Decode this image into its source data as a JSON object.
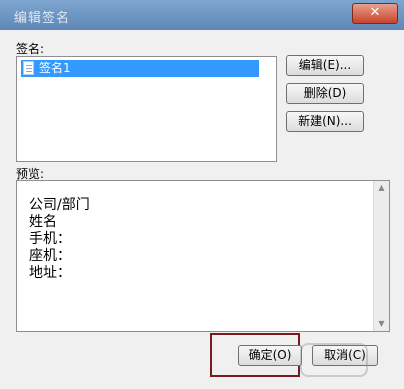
{
  "window": {
    "title": "编辑签名",
    "close_glyph": "✕"
  },
  "signatures": {
    "label": "签名:",
    "items": [
      "签名1"
    ]
  },
  "buttons": {
    "edit": "编辑(E)...",
    "delete": "删除(D)",
    "new": "新建(N)...",
    "ok": "确定(O)",
    "cancel": "取消(C)"
  },
  "preview": {
    "label": "预览:",
    "lines": [
      "公司/部门",
      "姓名",
      "手机：",
      "座机：",
      "地址："
    ]
  },
  "colors": {
    "selection": "#3399ff",
    "highlight_box": "#7b1c1c"
  },
  "icons": {
    "signature_item": "document-icon",
    "scroll_up": "scroll-up-arrow-icon",
    "scroll_down": "scroll-down-arrow-icon"
  }
}
